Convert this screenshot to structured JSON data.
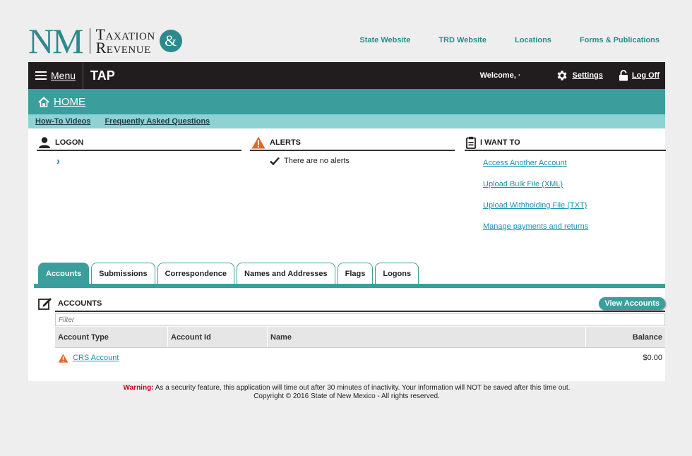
{
  "header": {
    "logo_nm": "NM",
    "logo_word1": "Taxation",
    "logo_word2": "Revenue",
    "logo_amp": "&",
    "links": [
      "State Website",
      "TRD Website",
      "Locations",
      "Forms & Publications"
    ]
  },
  "navbar": {
    "menu_label": "Menu",
    "app_title": "TAP",
    "welcome": "Welcome, ·",
    "settings": "Settings",
    "logoff": "Log Off"
  },
  "homebar": {
    "label": "HOME"
  },
  "subnav": {
    "how_to": "How-To Videos",
    "faq": "Frequently Asked Questions"
  },
  "logon": {
    "title": "LOGON"
  },
  "alerts": {
    "title": "ALERTS",
    "message": "There are no alerts"
  },
  "iwant": {
    "title": "I WANT TO",
    "items": [
      "Access Another Account",
      "Upload Bulk File (XML)",
      "Upload Withholding File (TXT)",
      "Manage payments and returns"
    ]
  },
  "tabs": [
    "Accounts",
    "Submissions",
    "Correspondence",
    "Names and Addresses",
    "Flags",
    "Logons"
  ],
  "accounts": {
    "title": "ACCOUNTS",
    "view_button": "View Accounts",
    "filter_placeholder": "Filter",
    "columns": [
      "Account Type",
      "Account Id",
      "Name",
      "Balance"
    ],
    "rows": [
      {
        "type": "CRS Account",
        "id": "",
        "name": "",
        "balance": "$0.00"
      }
    ]
  },
  "footer": {
    "warning_label": "Warning:",
    "warning_text": "As a security feature, this application will time out after 30 minutes of inactivity. Your information will NOT be saved after this time out.",
    "copyright": "Copyright © 2016 State of New Mexico - All rights reserved."
  },
  "colors": {
    "teal": "#3b9e9c",
    "light_teal": "#8ed2d3",
    "nav_black": "#211d1e",
    "alert_orange": "#e8671f",
    "link_blue": "#1a8fb0"
  }
}
